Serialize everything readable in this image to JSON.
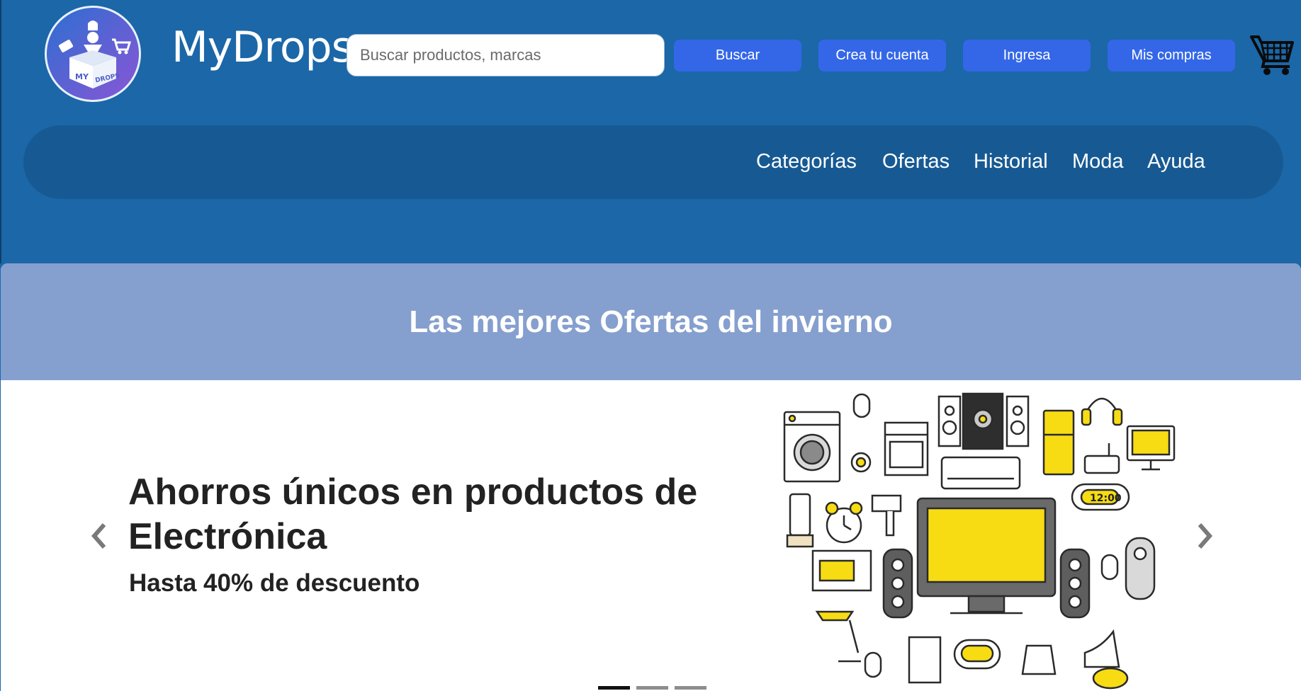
{
  "header": {
    "brand": "MyDrops",
    "logo_text_left": "MY",
    "logo_text_right": "DROPS",
    "search": {
      "placeholder": "Buscar productos, marcas",
      "value": ""
    },
    "buttons": [
      "Buscar",
      "Crea tu cuenta",
      "Ingresa",
      "Mis compras"
    ],
    "cart_icon": "shopping-cart-icon"
  },
  "nav": {
    "items": [
      "Categorías",
      "Ofertas",
      "Historial",
      "Moda",
      "Ayuda"
    ]
  },
  "promo": {
    "title": "Las mejores Ofertas del invierno",
    "headline": "Ahorros únicos en productos de Electrónica",
    "subline": "Hasta 40% de descuento",
    "clock_text": "12:00",
    "slides": {
      "count": 3,
      "active": 1
    }
  },
  "colors": {
    "header_bg": "#1b67a8",
    "nav_bg": "#175a93",
    "button_bg": "#3467e8",
    "promo_head_bg": "#859fcf",
    "accent_yellow": "#f7dc14"
  }
}
